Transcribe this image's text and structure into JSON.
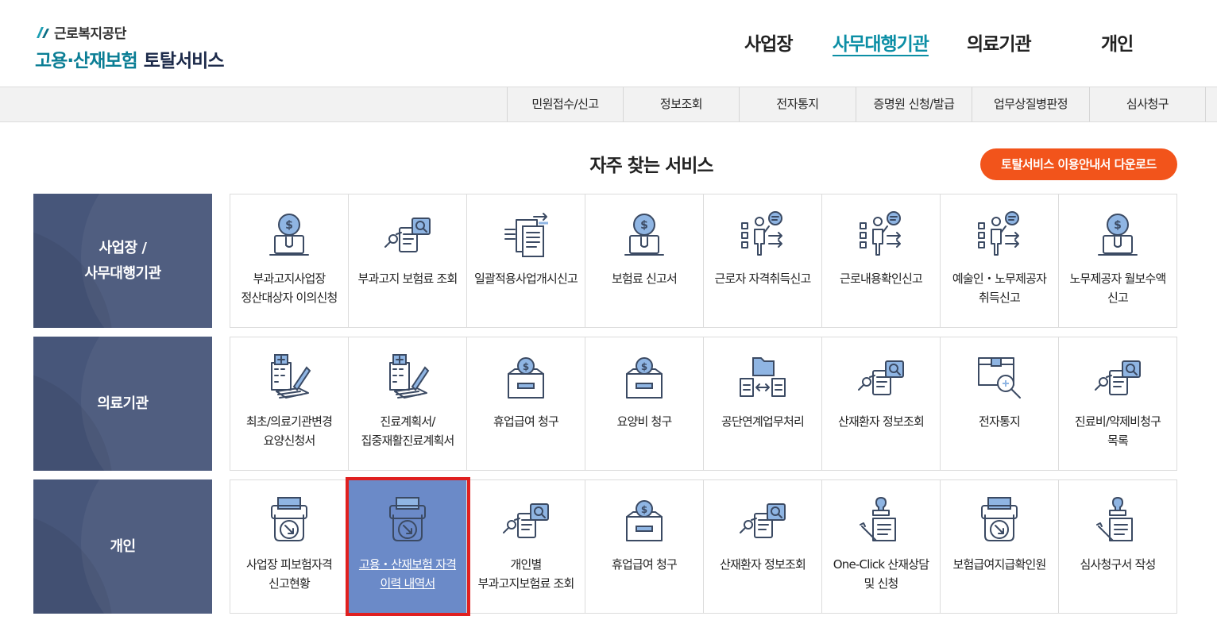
{
  "logo": {
    "org": "근로복지공단",
    "service_teal": "고용·산재보험",
    "service_dark": "토탈서비스"
  },
  "nav": {
    "items": [
      "사업장",
      "사무대행기관",
      "의료기관",
      "개인"
    ],
    "active": "사무대행기관"
  },
  "subnav": {
    "items": [
      "민원접수/신고",
      "정보조회",
      "전자통지",
      "증명원 신청/발급",
      "업무상질병판정",
      "심사청구"
    ]
  },
  "section": {
    "title": "자주 찾는 서비스",
    "download_label": "토탈서비스 이용안내서 다운로드"
  },
  "colors": {
    "accent_teal": "#0b8ea5",
    "button_orange": "#f2541b",
    "category_bg": "#47567a",
    "selected_bg": "#6b8ac8",
    "selected_border": "#e02020",
    "icon_stroke": "#3b4a63",
    "icon_fill": "#8fb5e3"
  },
  "categories": [
    {
      "label": "사업장 /\n사무대행기관",
      "tiles": [
        {
          "label": "부과고지사업장 정산대상자 이의신청",
          "icon": "money-laptop-icon"
        },
        {
          "label": "부과고지 보험료 조회",
          "icon": "document-magnifier-icon"
        },
        {
          "label": "일괄적용사업개시신고",
          "icon": "document-transfer-icon"
        },
        {
          "label": "보험료 신고서",
          "icon": "money-laptop-icon"
        },
        {
          "label": "근로자 자격취득신고",
          "icon": "presenter-checklist-icon"
        },
        {
          "label": "근로내용확인신고",
          "icon": "presenter-checklist-icon"
        },
        {
          "label": "예술인・노무제공자 취득신고",
          "icon": "presenter-checklist-icon"
        },
        {
          "label": "노무제공자 월보수액 신고",
          "icon": "money-laptop-icon"
        }
      ]
    },
    {
      "label": "의료기관",
      "tiles": [
        {
          "label": "최초/의료기관변경 요양신청서",
          "icon": "hospital-pen-icon"
        },
        {
          "label": "진료계획서/집중재활진료계획서",
          "icon": "hospital-pen-icon"
        },
        {
          "label": "휴업급여 청구",
          "icon": "coin-box-icon"
        },
        {
          "label": "요양비 청구",
          "icon": "coin-box-icon"
        },
        {
          "label": "공단연계업무처리",
          "icon": "folder-exchange-icon"
        },
        {
          "label": "산재환자 정보조회",
          "icon": "document-magnifier-icon"
        },
        {
          "label": "전자통지",
          "icon": "package-search-icon"
        },
        {
          "label": "진료비/약제비청구 목록",
          "icon": "document-magnifier-icon"
        }
      ]
    },
    {
      "label": "개인",
      "tiles": [
        {
          "label": "사업장 피보험자격 신고현황",
          "icon": "printer-arrow-icon"
        },
        {
          "label": "고용・산재보험 자격 이력 내역서",
          "icon": "printer-arrow-icon"
        },
        {
          "label": "개인별 부과고지보험료 조회",
          "icon": "document-magnifier-icon"
        },
        {
          "label": "휴업급여 청구",
          "icon": "coin-box-icon"
        },
        {
          "label": "산재환자 정보조회",
          "icon": "document-magnifier-icon"
        },
        {
          "label": "One-Click 산재상담 및 신청",
          "icon": "stamp-pen-icon"
        },
        {
          "label": "보험급여지급확인원",
          "icon": "printer-arrow-icon"
        },
        {
          "label": "심사청구서 작성",
          "icon": "stamp-pen-icon"
        }
      ]
    }
  ],
  "selected": {
    "category": 2,
    "tile": 1
  }
}
